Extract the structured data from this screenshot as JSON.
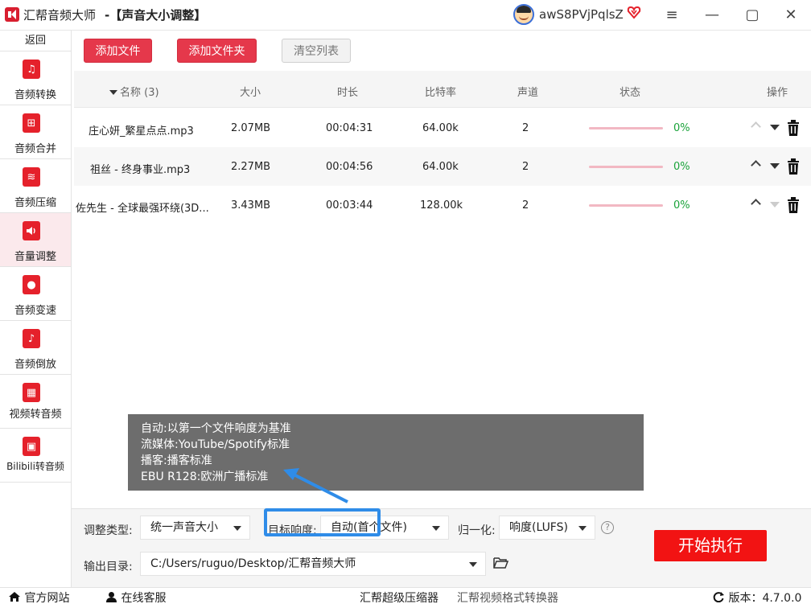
{
  "titlebar": {
    "app_name": "汇帮音频大师",
    "subtitle": "-【声音大小调整】",
    "username": "awS8PVjPqlsZ"
  },
  "sidebar": {
    "back": "返回",
    "items": [
      {
        "label": "音频转换",
        "icon": "music-convert-icon",
        "glyph": "♫"
      },
      {
        "label": "音频合并",
        "icon": "merge-icon",
        "glyph": "⊞"
      },
      {
        "label": "音频压缩",
        "icon": "waveform-icon",
        "glyph": "≋"
      },
      {
        "label": "音量调整",
        "icon": "speaker-icon",
        "glyph": "🔊",
        "active": true
      },
      {
        "label": "音频变速",
        "icon": "microphone-icon",
        "glyph": "●"
      },
      {
        "label": "音频倒放",
        "icon": "note-icon",
        "glyph": "♪"
      },
      {
        "label": "视频转音频",
        "icon": "film-icon",
        "glyph": "▦"
      },
      {
        "label": "Bilibili转音频",
        "icon": "tv-icon",
        "glyph": "▣"
      }
    ]
  },
  "toolbar": {
    "add_file": "添加文件",
    "add_folder": "添加文件夹",
    "clear_list": "清空列表"
  },
  "table": {
    "headers": {
      "name": "名称 (3)",
      "size": "大小",
      "duration": "时长",
      "bitrate": "比特率",
      "channels": "声道",
      "status": "状态",
      "actions": "操作"
    },
    "rows": [
      {
        "name": "庄心妍_繁星点点.mp3",
        "size": "2.07MB",
        "duration": "00:04:31",
        "bitrate": "64.00k",
        "channels": "2",
        "progress": "0%"
      },
      {
        "name": "祖丝 - 终身事业.mp3",
        "size": "2.27MB",
        "duration": "00:04:56",
        "bitrate": "64.00k",
        "channels": "2",
        "progress": "0%"
      },
      {
        "name": "佐先生 - 全球最强环绕(3D...",
        "size": "3.43MB",
        "duration": "00:03:44",
        "bitrate": "128.00k",
        "channels": "2",
        "progress": "0%"
      }
    ]
  },
  "tooltip": {
    "lines": [
      "自动:以第一个文件响度为基准",
      "流媒体:YouTube/Spotify标准",
      "播客:播客标准",
      "EBU R128:欧洲广播标准"
    ]
  },
  "settings": {
    "adjust_type_label": "调整类型:",
    "adjust_type_value": "统一声音大小",
    "target_label": "目标响度:",
    "target_value": "自动(首个文件)",
    "normalize_label": "归一化:",
    "normalize_value": "响度(LUFS)",
    "output_label": "输出目录:",
    "output_value": "C:/Users/ruguo/Desktop/汇帮音频大师",
    "start": "开始执行"
  },
  "footer": {
    "official_site": "官方网站",
    "online_service": "在线客服",
    "compressor": "汇帮超级压缩器",
    "video_converter": "汇帮视频格式转换器",
    "version_label": "版本：",
    "version": "4.7.0.0"
  },
  "colors": {
    "accent": "#e5384b",
    "start": "#f21313",
    "progress_text": "#1aa33a",
    "highlight": "#2f8ce8"
  }
}
